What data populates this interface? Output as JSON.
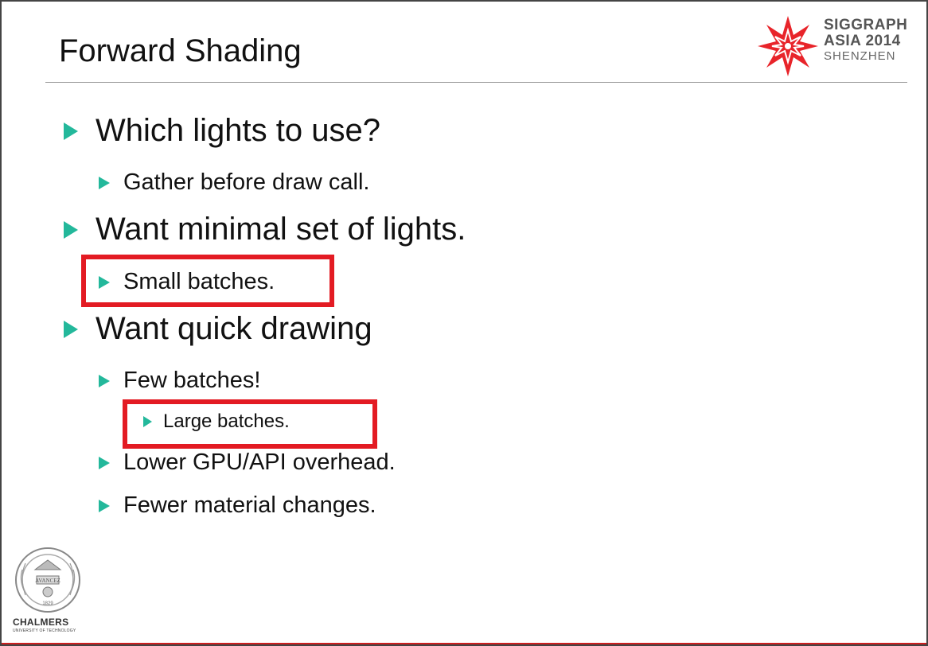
{
  "slide": {
    "title": "Forward Shading",
    "bullets": {
      "b1": "Which lights to use?",
      "b1_1": "Gather before draw call.",
      "b2": "Want minimal set of lights.",
      "b2_1": "Small batches.",
      "b3": "Want quick drawing",
      "b3_1": "Few batches!",
      "b3_1_1": "Large batches.",
      "b3_2": "Lower GPU/API overhead.",
      "b3_3": "Fewer material changes."
    }
  },
  "logos": {
    "siggraph_line1": "SIGGRAPH",
    "siggraph_line2": "ASIA 2014",
    "siggraph_line3": "SHENZHEN",
    "chalmers_name": "CHALMERS",
    "chalmers_sub": "UNIVERSITY OF TECHNOLOGY",
    "seal_text": "AVANCEZ",
    "seal_year": "1829"
  },
  "colors": {
    "bullet": "#23b89b",
    "highlight": "#e31b23",
    "siggraph_star": "#e8242a"
  }
}
